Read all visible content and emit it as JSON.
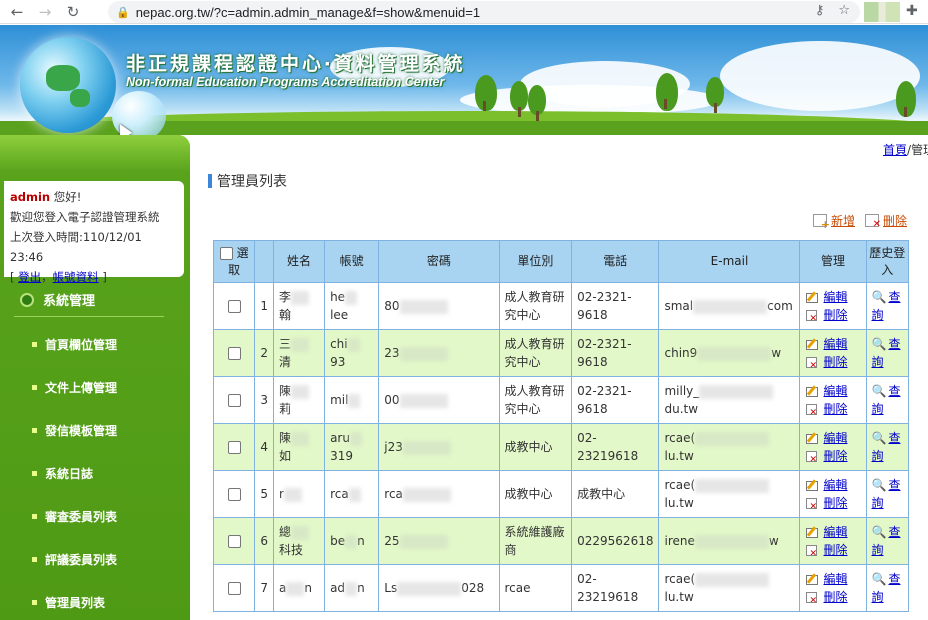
{
  "browser": {
    "url": "nepac.org.tw/?c=admin.admin_manage&f=show&menuid=1"
  },
  "banner": {
    "title_cn": "非正規課程認證中心‧資料管理系統",
    "title_en": "Non-formal Education Programs Accreditation Center"
  },
  "user": {
    "name": "admin",
    "greeting": "您好!",
    "welcome": "歡迎您登入電子認證管理系統",
    "last_login_label": "上次登入時間:110/12/01 23:46",
    "logout": "登出",
    "account": "帳號資料",
    "bracket_open": "[",
    "sep": "，",
    "bracket_close": "]"
  },
  "menu": {
    "header": "系統管理",
    "items": [
      "首頁欄位管理",
      "文件上傳管理",
      "發信模板管理",
      "系統日誌",
      "審查委員列表",
      "評議委員列表",
      "管理員列表"
    ]
  },
  "breadcrumb": {
    "home": "首頁",
    "sep": "/",
    "current": "管理"
  },
  "page_title": "管理員列表",
  "actions": {
    "add": "新增",
    "delete": "刪除"
  },
  "table": {
    "headers": [
      "選取",
      "",
      "姓名",
      "帳號",
      "密碼",
      "單位別",
      "電話",
      "E-mail",
      "管理",
      "歷史登入"
    ],
    "edit_label": "編輯",
    "delete_label": "刪除",
    "history_label": "查詢",
    "rows": [
      {
        "no": "1",
        "name_a": "李",
        "name_b": "翰",
        "acct_a": "he",
        "acct_b": "lee",
        "pw": "80",
        "unit": "成人教育研究中心",
        "phone": "02-2321-9618",
        "email_a": "smal",
        "email_b": "com"
      },
      {
        "no": "2",
        "name_a": "三",
        "name_b": "清",
        "acct_a": "chi",
        "acct_b": "93",
        "pw": "23",
        "unit": "成人教育研究中心",
        "phone": "02-2321-9618",
        "email_a": "chin9",
        "email_b": "w"
      },
      {
        "no": "3",
        "name_a": "陳",
        "name_b": "莉",
        "acct_a": "mil",
        "acct_b": "",
        "pw": "00",
        "unit": "成人教育研究中心",
        "phone": "02-2321-9618",
        "email_a": "milly_",
        "email_b": "du.tw"
      },
      {
        "no": "4",
        "name_a": "陳",
        "name_b": "如",
        "acct_a": "aru",
        "acct_b": "319",
        "pw": "j23",
        "unit": "成教中心",
        "phone": "02-23219618",
        "email_a": "rcae(",
        "email_b": "lu.tw"
      },
      {
        "no": "5",
        "name_a": "r",
        "name_b": "",
        "acct_a": "rca",
        "acct_b": "",
        "pw": "rca",
        "unit": "成教中心",
        "phone": "成教中心",
        "email_a": "rcae(",
        "email_b": "lu.tw"
      },
      {
        "no": "6",
        "name_a": "總",
        "name_b": "科技",
        "acct_a": "be",
        "acct_b": "n",
        "pw": "25",
        "unit": "系統維護廠商",
        "phone": "0229562618",
        "email_a": "irene",
        "email_b": "w"
      },
      {
        "no": "7",
        "name_a": "a",
        "name_b": "n",
        "acct_a": "ad",
        "acct_b": "n",
        "pw": "Ls",
        "pw_b": "028",
        "unit": "rcae",
        "phone": "02-23219618",
        "email_a": "rcae(",
        "email_b": "lu.tw"
      }
    ]
  }
}
